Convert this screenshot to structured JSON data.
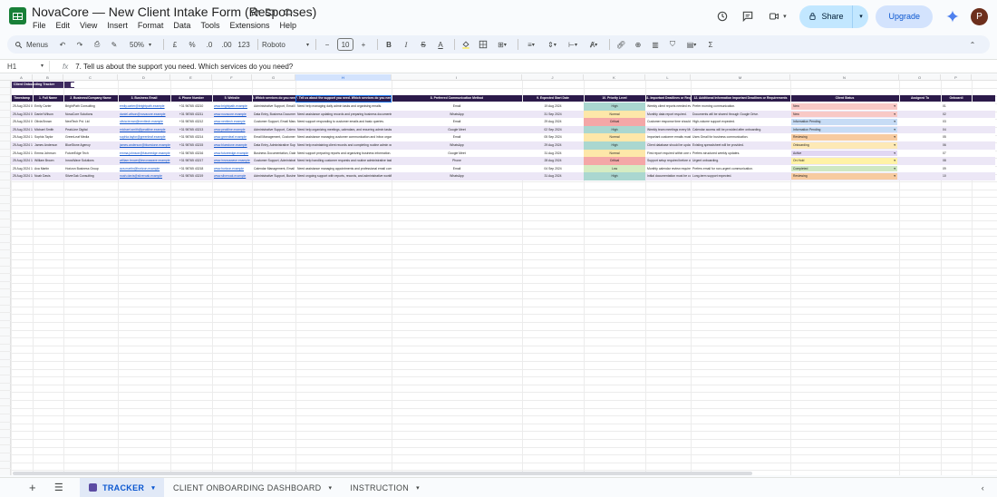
{
  "doc": {
    "title": "NovaCore — New Client Intake Form  (Responses)"
  },
  "menu": [
    "File",
    "Edit",
    "View",
    "Insert",
    "Format",
    "Data",
    "Tools",
    "Extensions",
    "Help"
  ],
  "actions": {
    "share": "Share",
    "upgrade": "Upgrade",
    "avatar": "P"
  },
  "toolbar": {
    "search": "Menus",
    "zoom": "50%",
    "currency": "£",
    "percent": "%",
    "dec_down": ".0",
    "dec_up": ".00",
    "format123": "123",
    "font": "Roboto",
    "font_size": "10"
  },
  "formula": {
    "cell": "H1",
    "content": "7. Tell us about the support you need. Which services do you need?"
  },
  "columns": [
    "A",
    "B",
    "C",
    "D",
    "E",
    "F",
    "G",
    "H",
    "I",
    "J",
    "K",
    "L",
    "M",
    "N",
    "O",
    "P"
  ],
  "section_title": "Client Onboarding Tracker",
  "headers": [
    "Timestamp",
    "1. Full Name",
    "2. Business/Company Name",
    "3. Business Email",
    "4. Phone Number",
    "5. Website",
    "6. Which services do you need?",
    "7. Tell us about the support you need. Which services do you need?",
    "8. Preferred Communication Method",
    "9. Expected Start Date",
    "10. Priority Level",
    "11. Important Deadlines or Requirements",
    "12. Additional Information Important Deadlines or Requirements",
    "Client Status",
    "Assigned To",
    "Onboardi"
  ],
  "rows": [
    [
      "25 Aug 2024 09:13",
      "Emily Carter",
      "BrightPath Consulting",
      "emily.carter@brightpath.example",
      "+31 96765 43210",
      "www.brightpath.example",
      "Administrative Support, Email Management",
      "Need help managing daily admin tasks and organising emails.",
      "Email",
      "19 Aug 2024",
      "High",
      "Weekly client reports needed every Friday.",
      "Prefer morning communication.",
      "New",
      "",
      "01"
    ],
    [
      "25 Aug 2024 09:26",
      "Daniel Wilson",
      "NovaCore Solutions",
      "daniel.wilson@novacore.example",
      "+31 98765 43211",
      "www.novacore.example",
      "Data Entry, Business Documentation",
      "Need assistance updating records and preparing business documents.",
      "WhatsApp",
      "31 Sep 2024",
      "Normal",
      "Monthly data report required.",
      "Documents will be shared through Google Drive.",
      "New",
      "",
      "02"
    ],
    [
      "25 Aug 2024 09:40",
      "Olivia Brown",
      "NextTech Pvt. Ltd",
      "olivia.brown@nexttech.example",
      "+31 98765 43212",
      "www.nexttech.example",
      "Customer Support, Email Management",
      "Need support responding to customer emails and basic queries.",
      "Email",
      "29 Aug 2024",
      "Critical",
      "Customer response time should remain under 24 hours.",
      "High-volume support expected.",
      "Information Pending",
      "",
      "03"
    ],
    [
      "25 Aug 2024 10:05",
      "Michael Smith",
      "PeakLine Digital",
      "michael.smith@peakline.example",
      "+31 98765 43213",
      "www.peakline.example",
      "Administrative Support, Calendar Management",
      "Need help organizing meetings, calendars, and recurring admin tasks.",
      "Google Meet",
      "02 Sep 2024",
      "High",
      "Weekly team meetings every Monday.",
      "Calendar access will be provided after onboarding.",
      "Information Pending",
      "",
      "04"
    ],
    [
      "25 Aug 2024 10:20",
      "Sophia Taylor",
      "GreenLeaf Media",
      "sophia.taylor@greenleaf.example",
      "+31 98765 43214",
      "www.greenleaf.example",
      "Email Management, Customer Support",
      "Need assistance managing customer communication and inbox organization.",
      "Email",
      "05 Sep 2024",
      "Normal",
      "Important customer emails must be flagged.",
      "Uses Gmail for business communication.",
      "Reviewing",
      "",
      "05"
    ],
    [
      "25 Aug 2024 10:47",
      "James Anderson",
      "BlueStone Agency",
      "james.anderson@bluestone.example",
      "+31 98765 43215",
      "www.bluestone.example",
      "Data Entry, Administrative Support",
      "Need help maintaining client records and completing routine admin work.",
      "WhatsApp",
      "29 Aug 2024",
      "High",
      "Client database should be updated weekly.",
      "Existing spreadsheet will be provided.",
      "Onboarding",
      "",
      "06"
    ],
    [
      "25 Aug 2024 11:08",
      "Emma Johnson",
      "FutureEdge Tech",
      "emma.johnson@futureedge.example",
      "+31 98765 43216",
      "www.futureedge.example",
      "Business Documentation, Data Entry",
      "Need support preparing reports and organizing business information.",
      "Google Meet",
      "31 Aug 2024",
      "Normal",
      "First report required within one week of starting.",
      "Prefers structured weekly updates.",
      "Active",
      "",
      "07"
    ],
    [
      "25 Aug 2024 11:33",
      "William Brown",
      "InnovWave Solutions",
      "william.brown@innovawave.example",
      "+31 98765 43217",
      "www.innovawave.example",
      "Customer Support, Administrative Support",
      "Need help handling customer requests and routine administrative tasks.",
      "Phone",
      "28 Aug 2024",
      "Critical",
      "Support setup required before client launch.",
      "Urgent onboarding.",
      "On Hold",
      "",
      "08"
    ],
    [
      "25 Aug 2024 11:50",
      "Ava Martin",
      "Horizon Business Group",
      "ava.martin@horizon.example",
      "+31 98765 43218",
      "www.horizon.example",
      "Calendar Management, Email Management",
      "Need assistance managing appointments and professional email communication.",
      "Email",
      "04 Sep 2024",
      "Low",
      "Monthly calendar review required.",
      "Prefers email for non-urgent communication.",
      "Completed",
      "",
      "09"
    ],
    [
      "25 Aug 2024 12:09",
      "Noah Davis",
      "SilverOak Consulting",
      "noah.davis@silveroak.example",
      "+31 98765 43219",
      "www.silveroak.example",
      "Administrative Support, Business Documentation, Data Entry",
      "Need ongoing support with reports, records, and administrative workflows.",
      "WhatsApp",
      "31 Aug 2024",
      "High",
      "Initial documentation must be completed before onboarding.",
      "Long-term support expected.",
      "Reviewing",
      "",
      "10"
    ]
  ],
  "priority_colors": {
    "High": "#aad7d0",
    "Normal": "#fde7a9",
    "Critical": "#f4a7a7",
    "Low": "#d5ecc2"
  },
  "status_colors": {
    "New": "#f8c9c6",
    "Information Pending": "#c7dcf5",
    "Reviewing": "#f7cba0",
    "Onboarding": "#fde9b6",
    "Active": "#e1d7f3",
    "On Hold": "#fff2a6",
    "Completed": "#cfe8c2"
  },
  "sheets": [
    "TRACKER",
    "CLIENT ONBOARDING DASHBOARD",
    "INSTRUCTION"
  ]
}
